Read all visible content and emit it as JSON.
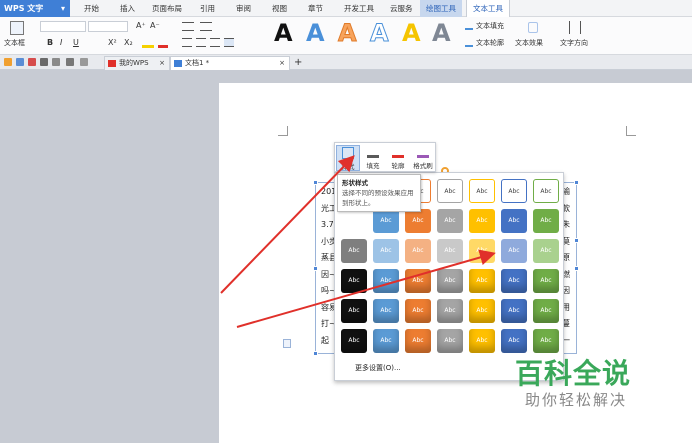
{
  "app": {
    "name": "WPS 文字",
    "caret": "▾"
  },
  "menu": [
    {
      "label": "开始"
    },
    {
      "label": "插入"
    },
    {
      "label": "页面布局"
    },
    {
      "label": "引用"
    },
    {
      "label": "审阅"
    },
    {
      "label": "视图"
    },
    {
      "label": "章节"
    },
    {
      "label": "开发工具"
    },
    {
      "label": "云服务"
    },
    {
      "label": "绘图工具"
    },
    {
      "label": "文本工具"
    }
  ],
  "ribbon": {
    "textbox_label": "文本框",
    "text_fill": "文本填充",
    "text_outline": "文本轮廓",
    "text_effect": "文本效果",
    "text_direction": "文字方向",
    "bold": "B",
    "italic": "I",
    "underline": "U",
    "superscript": "X²",
    "subscript": "X₂",
    "grow_font": "A⁺",
    "shrink_font": "A⁻"
  },
  "tabs": [
    {
      "label": "我的WPS",
      "close": "×"
    },
    {
      "label": "文档1 *",
      "close": "×"
    },
    {
      "label": "+"
    }
  ],
  "mini_toolbar": {
    "style": "样式",
    "fill": "填充",
    "outline": "轮廓",
    "format_painter": "格式刷"
  },
  "tooltip": {
    "title": "形状样式",
    "body": "选择不同的预设效果应用到形状上。"
  },
  "gallery": {
    "swatch_label": "Abc",
    "more": "更多设置(O)..."
  },
  "doc_text": {
    "left_lines": [
      "201",
      "光工",
      "3.75",
      "小步",
      "蒸县",
      "因~",
      "吗~",
      "容易",
      "打~",
      "起",
      "氧化",
      "随身",
      "至置"
    ],
    "right_lines": [
      "输",
      "款",
      "朱",
      "莫",
      "原",
      "燃",
      "因",
      "用",
      "蔓",
      "一",
      "设",
      "迎"
    ]
  },
  "watermark": {
    "line1": "百科全说",
    "line2": "助你轻松解决"
  },
  "colors": {
    "accent": "#3f7fd6",
    "arrow": "#e0302a",
    "watermark": "#3aa85a"
  }
}
